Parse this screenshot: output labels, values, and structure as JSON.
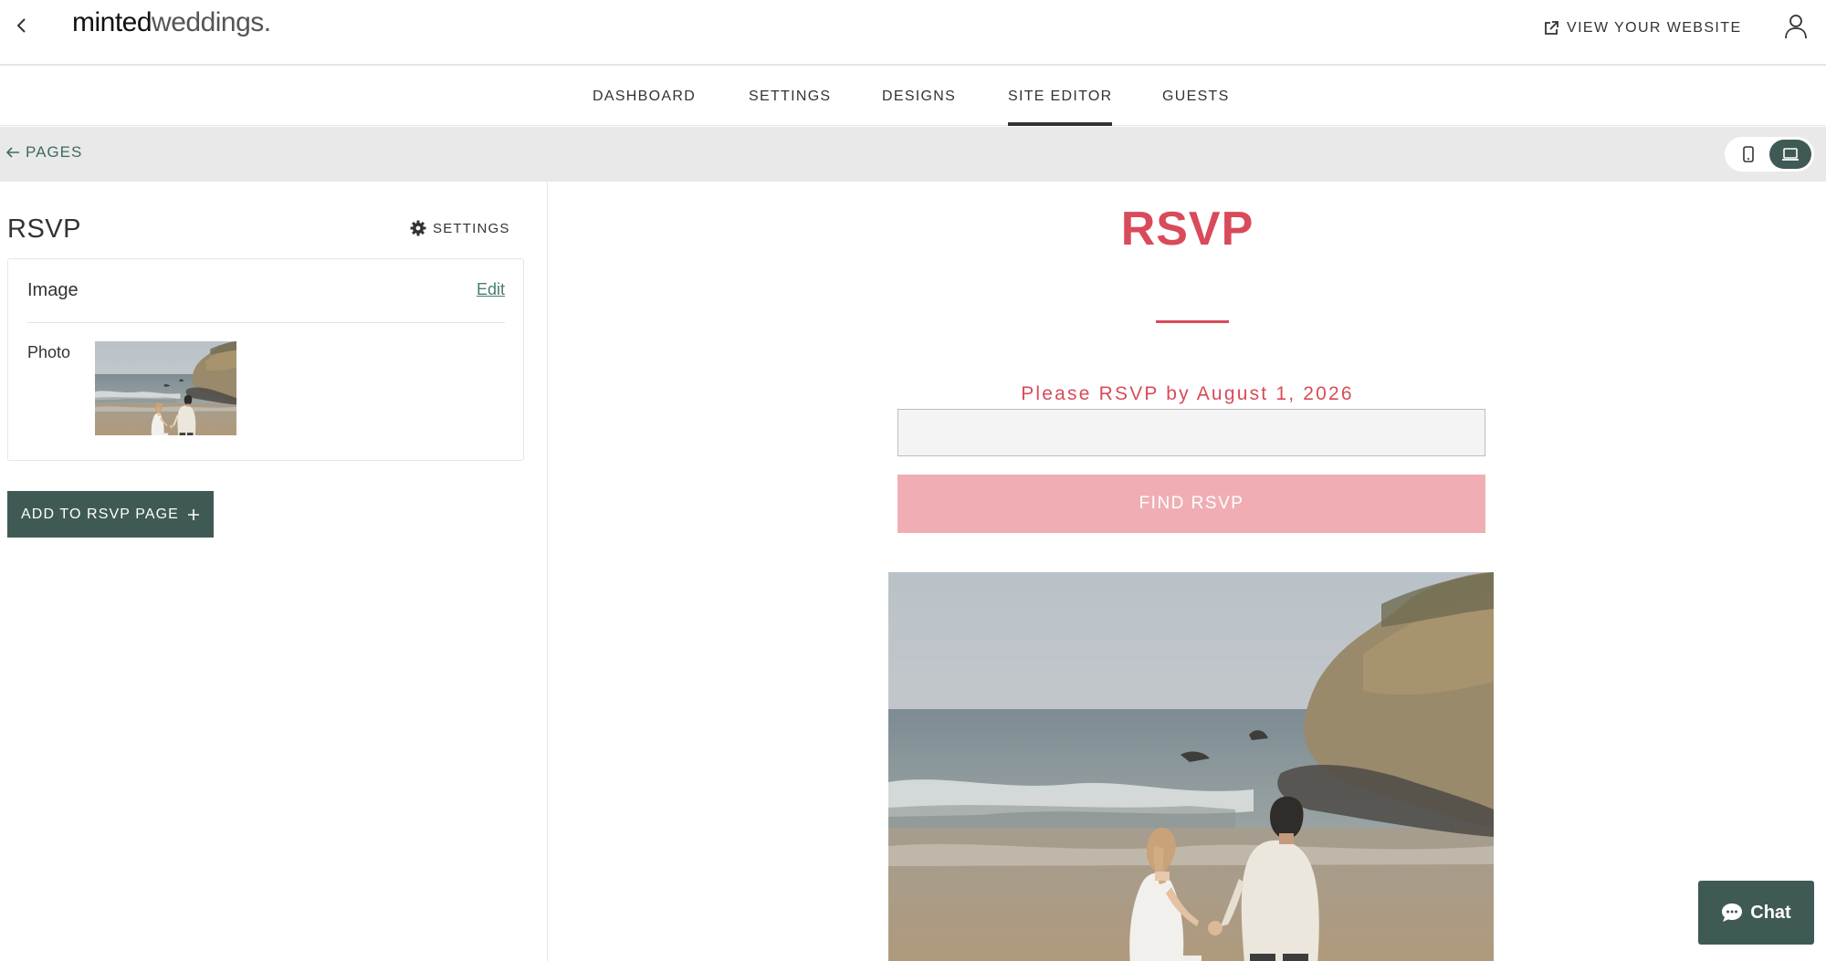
{
  "header": {
    "logo_bold": "minted",
    "logo_light": "weddings.",
    "view_site_label": "VIEW YOUR WEBSITE"
  },
  "nav": {
    "tabs": [
      {
        "label": "DASHBOARD",
        "active": false
      },
      {
        "label": "SETTINGS",
        "active": false
      },
      {
        "label": "DESIGNS",
        "active": false
      },
      {
        "label": "SITE EDITOR",
        "active": true
      },
      {
        "label": "GUESTS",
        "active": false
      }
    ]
  },
  "pagesbar": {
    "back_label": "PAGES",
    "device": "desktop"
  },
  "editor": {
    "title": "RSVP",
    "settings_label": "SETTINGS",
    "card": {
      "title": "Image",
      "edit_label": "Edit",
      "photo_label": "Photo"
    },
    "add_button_label": "ADD TO RSVP PAGE"
  },
  "preview": {
    "heading": "RSVP",
    "rsvp_by": "Please RSVP by August 1, 2026",
    "input_value": "",
    "find_button_label": "FIND RSVP"
  },
  "chat": {
    "label": "Chat"
  },
  "colors": {
    "accent": "#d94a5a",
    "button_pink": "#f0aeb4",
    "primary_dark": "#3f5a55",
    "link_green": "#4b7c72"
  }
}
